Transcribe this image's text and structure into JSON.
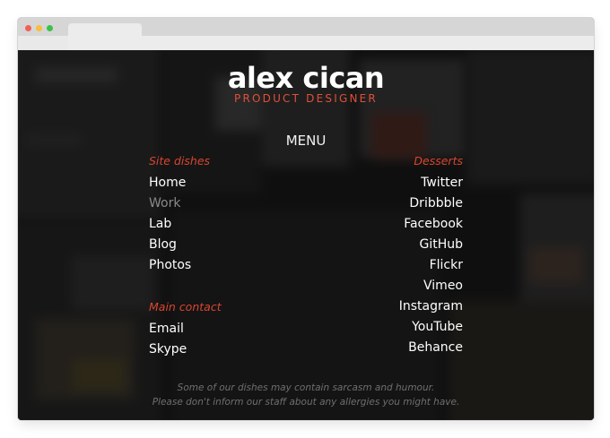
{
  "brand": {
    "name": "alex cican",
    "tagline": "PRODUCT DESIGNER"
  },
  "menu": {
    "title": "MENU",
    "left_sections": [
      {
        "heading": "Site dishes",
        "items": [
          {
            "label": "Home",
            "active": false
          },
          {
            "label": "Work",
            "active": true
          },
          {
            "label": "Lab",
            "active": false
          },
          {
            "label": "Blog",
            "active": false
          },
          {
            "label": "Photos",
            "active": false
          }
        ]
      },
      {
        "heading": "Main contact",
        "items": [
          {
            "label": "Email",
            "active": false
          },
          {
            "label": "Skype",
            "active": false
          }
        ]
      }
    ],
    "right_section": {
      "heading": "Desserts",
      "items": [
        {
          "label": "Twitter"
        },
        {
          "label": "Dribbble"
        },
        {
          "label": "Facebook"
        },
        {
          "label": "GitHub"
        },
        {
          "label": "Flickr"
        },
        {
          "label": "Vimeo"
        },
        {
          "label": "Instagram"
        },
        {
          "label": "YouTube"
        },
        {
          "label": "Behance"
        }
      ]
    }
  },
  "footer": {
    "line1": "Some of our dishes may contain sarcasm and humour.",
    "line2": "Please don't inform our staff about any allergies you might have."
  },
  "colors": {
    "accent": "#d9452f",
    "text": "#ffffff",
    "muted": "#8a8a8a"
  }
}
